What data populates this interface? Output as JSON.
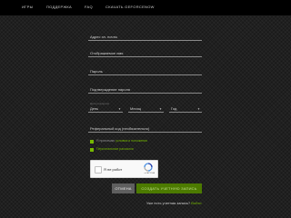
{
  "nav": {
    "items": [
      {
        "label": "ИГРЫ"
      },
      {
        "label": "ПОДДЕРЖКА"
      },
      {
        "label": "FAQ"
      },
      {
        "label": "СКАЧАТЬ GEFORCENOW"
      }
    ]
  },
  "form": {
    "email_label": "Адрес эл. почты",
    "display_name_label": "Отображаемое имя",
    "password_label": "Пароль",
    "confirm_password_label": "Подтверждение пароля",
    "birthdate_hint": "Дата рождения",
    "day_label": "День",
    "month_label": "Месяц",
    "year_label": "Год",
    "referral_label": "Реферальный код (необязательно)",
    "checks": [
      {
        "prefix": "Я принимаю ",
        "link": "условия и положения",
        "checked": true
      },
      {
        "prefix": "",
        "link": "Персональные рассылки",
        "checked": true
      }
    ],
    "captcha": {
      "label": "Я не робот",
      "brand": "reCAPTCHA"
    },
    "cancel_label": "ОТМЕНА",
    "create_label": "СОЗДАТЬ УЧЕТНУЮ ЗАПИСЬ",
    "signin_prompt": "Уже есть учетная запись?",
    "signin_link": "Войти"
  },
  "colors": {
    "accent": "#76b900",
    "nav_bg": "#000000",
    "page_bg": "#202020",
    "cancel_bg": "#5f5f5f",
    "create_bg": "#4c7a00"
  },
  "icons": {
    "select_chevron": "chevron-down-icon",
    "captcha_logo": "recaptcha-icon",
    "checkbox": "checkbox-checked-icon"
  }
}
